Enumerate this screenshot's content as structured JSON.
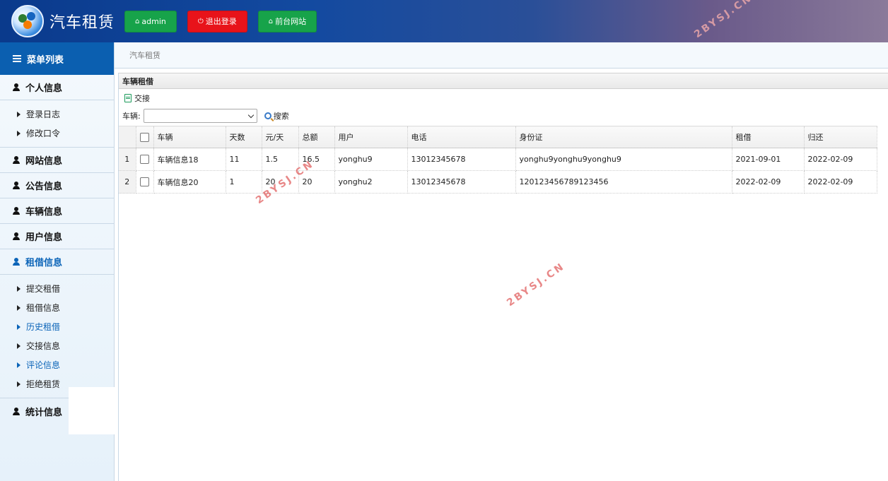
{
  "header": {
    "app_title": "汽车租赁",
    "buttons": [
      {
        "label": "admin",
        "icon": "home-icon",
        "color": "#17a34a"
      },
      {
        "label": "退出登录",
        "icon": "power-icon",
        "color": "#e8131a"
      },
      {
        "label": "前台网站",
        "icon": "home-icon",
        "color": "#17a34a"
      }
    ]
  },
  "sidebar": {
    "title": "菜单列表",
    "sections": [
      {
        "label": "个人信息",
        "items": [
          "登录日志",
          "修改口令"
        ]
      },
      {
        "label": "网站信息"
      },
      {
        "label": "公告信息"
      },
      {
        "label": "车辆信息"
      },
      {
        "label": "用户信息"
      },
      {
        "label": "租借信息",
        "items": [
          "提交租借",
          "租借信息",
          "历史租借",
          "交接信息",
          "评论信息",
          "拒绝租赁"
        ]
      },
      {
        "label": "统计信息"
      }
    ]
  },
  "breadcrumb": "汽车租赁",
  "panel": {
    "title": "车辆租借",
    "toolbar_handover": "交接",
    "filter_label": "车辆:",
    "search_label": "搜索"
  },
  "table": {
    "columns": [
      "车辆",
      "天数",
      "元/天",
      "总额",
      "用户",
      "电话",
      "身份证",
      "租借",
      "归还"
    ],
    "rows": [
      {
        "no": "1",
        "cells": [
          "车辆信息18",
          "11",
          "1.5",
          "16.5",
          "yonghu9",
          "13012345678",
          "yonghu9yonghu9yonghu9",
          "2021-09-01",
          "2022-02-09"
        ]
      },
      {
        "no": "2",
        "cells": [
          "车辆信息20",
          "1",
          "20",
          "20",
          "yonghu2",
          "13012345678",
          "120123456789123456",
          "2022-02-09",
          "2022-02-09"
        ]
      }
    ]
  },
  "watermark": "2BYSJ.CN"
}
